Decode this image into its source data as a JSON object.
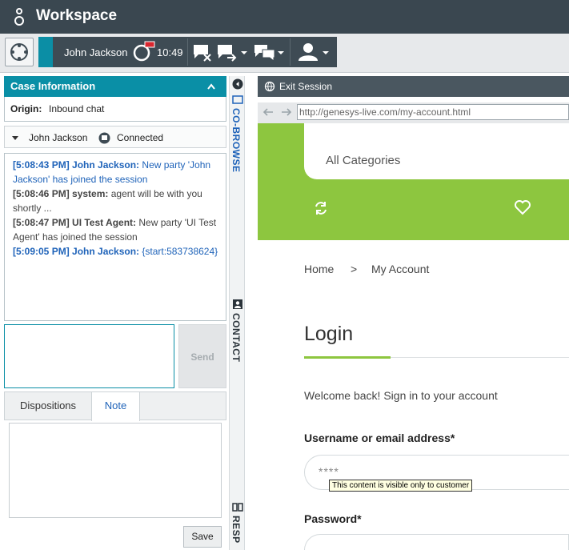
{
  "app": {
    "title": "Workspace"
  },
  "toolbar": {
    "party_name": "John Jackson",
    "timer": "10:49",
    "icons": [
      "target-icon",
      "chat-status-icon",
      "end-chat-icon",
      "transfer-chat-icon",
      "consult-chat-icon",
      "agent-status-icon"
    ]
  },
  "case_info": {
    "header": "Case Information",
    "origin_label": "Origin:",
    "origin_value": "Inbound chat"
  },
  "party": {
    "name": "John Jackson",
    "status": "Connected"
  },
  "transcript": [
    {
      "time": "[5:08:43 PM]",
      "sender": "John Jackson:",
      "text": "New party 'John Jackson' has joined the session",
      "color": "#1f63b9"
    },
    {
      "time": "[5:08:46 PM]",
      "sender": "system:",
      "text": "agent will be with you shortly ...",
      "color": "#444444"
    },
    {
      "time": "[5:08:47 PM]",
      "sender": "UI Test Agent:",
      "text": "New party 'UI Test Agent' has joined the session",
      "color": "#444444"
    },
    {
      "time": "[5:09:05 PM]",
      "sender": "John Jackson:",
      "text": "{start:583738624}",
      "color": "#1f63b9"
    }
  ],
  "compose": {
    "send_label": "Send"
  },
  "tabs": {
    "dispositions": "Dispositions",
    "note": "Note"
  },
  "note": {
    "save_label": "Save"
  },
  "side_tabs": {
    "cobrowse": "CO-BROWSE",
    "contact": "CONTACT",
    "responses": "RESP"
  },
  "browser": {
    "exit_label": "Exit Session",
    "url": "http://genesys-live.com/my-account.html"
  },
  "site": {
    "categories": "All Categories",
    "breadcrumb": {
      "home": "Home",
      "sep": ">",
      "current": "My Account"
    },
    "login_title": "Login",
    "welcome": "Welcome back! Sign in to your account",
    "username_label": "Username or email address*",
    "username_mask": "****",
    "tooltip": "This content is visible only to customer",
    "password_label": "Password*"
  },
  "colors": {
    "accent": "#0a8fa6",
    "brand_green": "#8dc63f",
    "header": "#3a4750"
  }
}
